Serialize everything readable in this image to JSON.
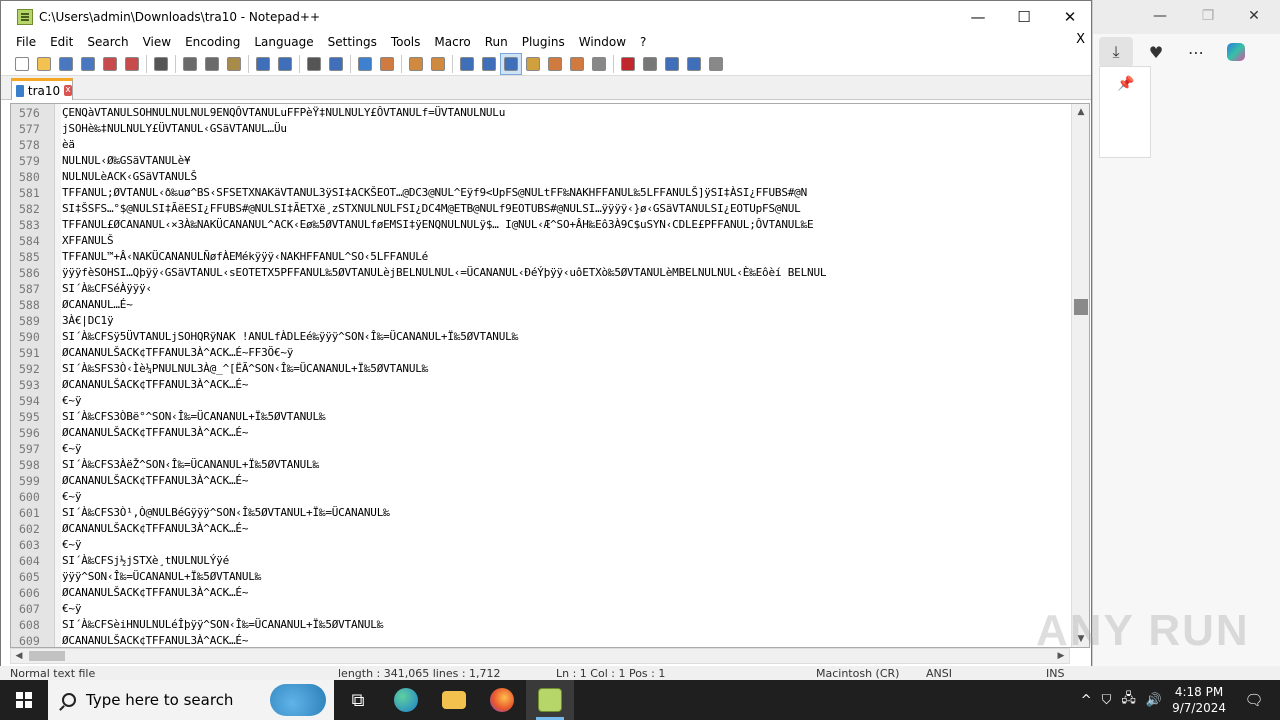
{
  "window": {
    "title": "C:\\Users\\admin\\Downloads\\tra10 - Notepad++",
    "minimize": "—",
    "maximize": "☐",
    "close": "✕"
  },
  "menu": [
    "File",
    "Edit",
    "Search",
    "View",
    "Encoding",
    "Language",
    "Settings",
    "Tools",
    "Macro",
    "Run",
    "Plugins",
    "Window",
    "?"
  ],
  "menu_close": "X",
  "tab": {
    "label": "tra10",
    "close": "x"
  },
  "lines": [
    {
      "n": "576",
      "t": "ÇENQàVTANULSOHNULNULNUL9ENQÔVTANULuFFPèŸ‡NULNULY£ÔVTANULf=ÜVTANULNULu"
    },
    {
      "n": "577",
      "t": "jSOHè‰‡NULNULY£ÜVTANUL‹GSäVTANUL…Üu"
    },
    {
      "n": "578",
      "t": "èä"
    },
    {
      "n": "579",
      "t": "NULNUL‹Ø‰GSäVTANULè¥"
    },
    {
      "n": "580",
      "t": "NULNULèACK‹GSäVTANULŠ"
    },
    {
      "n": "581",
      "t": "TFFANUL;ØVTANUL‹ð‰uø^BS‹SFSETXNAKäVTANUL3ÿSI‡ACKŠEOT…@DC3@NUL^Eÿf9<UpFS@NULtFF‰NAKHFFANUL‰5LFFANULŠ]ÿSI‡ÀSI¿FFUBS#@N"
    },
    {
      "n": "582",
      "t": "SI‡ŠSFS…°$@NULSI‡ÃëESI¿FFUBS#@NULSI‡ÃETXë¸zSTXNULNULFSI¿DC4M@ETB@NULf9EOTUBS#@NULSI…ÿÿÿÿ‹}ø‹GSäVTANULSI¿EOTUpFS@NUL"
    },
    {
      "n": "583",
      "t": "TFFANUL£ØCANANUL‹×3À‰NAKÜCANANUL^ACK‹Eø‰5ØVTANULføEMSI‡ÿENQNULNULÿ$… I@NUL‹Æ^SO+ÂH‰Eô3À9C$uSYN‹CDLE£PFFANUL;ÔVTANUL‰E"
    },
    {
      "n": "584",
      "t": "XFFANULŠ"
    },
    {
      "n": "585",
      "t": "TFFANUL™+Â‹NAKÜCANANULÑøfÀEMékÿÿÿ‹NAKHFFANUL^SO‹5LFFANULé"
    },
    {
      "n": "586",
      "t": "ÿÿÿfèSOHSI…Qþÿÿ‹GSäVTANUL‹sEOTETX5PFFANUL‰5ØVTANULèjBELNULNUL‹=ÜCANANUL‹ÐéÝþÿÿ‹uôETXò‰5ØVTANULèMBELNULNUL‹È‰Eôèí BELNUL"
    },
    {
      "n": "587",
      "t": "SI´À‰CFSéÀÿÿÿ‹"
    },
    {
      "n": "588",
      "t": "ØCANANUL…É~"
    },
    {
      "n": "589",
      "t": "3À€|DC1ÿ"
    },
    {
      "n": "590",
      "t": "SI´À‰CFSÿ5ÜVTANULjSOHQRÿNAK !ANULfÀDLEé‰ÿÿÿ^SON‹Î‰=ÜCANANUL+Ï‰5ØVTANUL‰"
    },
    {
      "n": "591",
      "t": "ØCANANULŠACK¢TFFANUL3À^ACK…É~FF3Ö€~ÿ"
    },
    {
      "n": "592",
      "t": "SI´À‰SFS3Ò‹Ìè¼PNULNUL3À@_^[ËÃ^SON‹Î‰=ÜCANANUL+Ï‰5ØVTANUL‰"
    },
    {
      "n": "593",
      "t": "ØCANANULŠACK¢TFFANUL3À^ACK…É~"
    },
    {
      "n": "594",
      "t": "€~ÿ"
    },
    {
      "n": "595",
      "t": "SI´À‰CFS3ÒBë°^SON‹Î‰=ÜCANANUL+Ï‰5ØVTANUL‰"
    },
    {
      "n": "596",
      "t": "ØCANANULŠACK¢TFFANUL3À^ACK…É~"
    },
    {
      "n": "597",
      "t": "€~ÿ"
    },
    {
      "n": "598",
      "t": "SI´À‰CFS3ÀëŽ^SON‹Î‰=ÜCANANUL+Ï‰5ØVTANUL‰"
    },
    {
      "n": "599",
      "t": "ØCANANULŠACK¢TFFANUL3À^ACK…É~"
    },
    {
      "n": "600",
      "t": "€~ÿ"
    },
    {
      "n": "601",
      "t": "SI´À‰CFS3Ò¹,Ò@NULBéGÿÿÿ^SON‹Î‰5ØVTANUL+Ï‰=ÜCANANUL‰"
    },
    {
      "n": "602",
      "t": "ØCANANULŠACK¢TFFANUL3À^ACK…É~"
    },
    {
      "n": "603",
      "t": "€~ÿ"
    },
    {
      "n": "604",
      "t": "SI´À‰CFSj½jSTXè¸tNULNULÝÿé"
    },
    {
      "n": "605",
      "t": "ÿÿÿ^SON‹Î‰=ÜCANANUL+Ï‰5ØVTANUL‰"
    },
    {
      "n": "606",
      "t": "ØCANANULŠACK¢TFFANUL3À^ACK…É~"
    },
    {
      "n": "607",
      "t": "€~ÿ"
    },
    {
      "n": "608",
      "t": "SI´À‰CFSèiHNULNULéÎþÿÿ^SON‹Î‰=ÜCANANUL+Ï‰5ØVTANUL‰"
    },
    {
      "n": "609",
      "t": "ØCANANULŠACK¢TFFANUL3À^ACK…É~"
    }
  ],
  "scroll": {
    "vertical_position": 0.36
  },
  "status": {
    "type": "Normal text file",
    "length": "length : 341,065    lines : 1,712",
    "pos": "Ln : 1    Col : 1    Pos : 1",
    "eol": "Macintosh (CR)",
    "enc": "ANSI",
    "ins": "INS"
  },
  "taskbar": {
    "search_placeholder": "Type here to search",
    "time": "4:18 PM",
    "date": "9/7/2024"
  },
  "watermark": "ANY RUN",
  "icons": {
    "toolbar": [
      "new-file-icon",
      "open-file-icon",
      "save-icon",
      "save-all-icon",
      "close-icon",
      "close-all-icon",
      "print-icon",
      "cut-icon",
      "copy-icon",
      "paste-icon",
      "undo-icon",
      "redo-icon",
      "find-icon",
      "replace-icon",
      "zoom-in-icon",
      "zoom-out-icon",
      "sync-v-icon",
      "sync-h-icon",
      "wrap-icon",
      "all-chars-icon",
      "indent-guide-icon",
      "doc-map-icon",
      "function-list-icon",
      "folder-workspace-icon",
      "monitor-icon",
      "record-macro-icon",
      "stop-macro-icon",
      "play-macro-icon",
      "run-multiple-macro-icon",
      "save-macro-icon"
    ]
  }
}
